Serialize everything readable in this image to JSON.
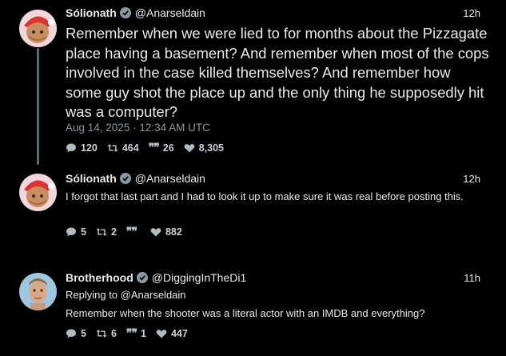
{
  "tweets": [
    {
      "author": "Sólionath",
      "handle": "@Anarseldain",
      "time": "12h",
      "text": "Remember when we were lied to for months about the Pizzagate place having a basement? And remember when most of the cops involved in the case killed themselves? And remember how some guy shot the place up and the only thing he supposedly hit was a computer?",
      "date": "Aug 14, 2025 · 12:34 AM UTC",
      "replies": "120",
      "retweets": "464",
      "quotes": "26",
      "likes": "8,305"
    },
    {
      "author": "Sólionath",
      "handle": "@Anarseldain",
      "time": "12h",
      "text": "I forgot that last part and I had to look it up to make sure it was real before posting this.",
      "replies": "5",
      "retweets": "2",
      "quotes": "",
      "likes": "882"
    },
    {
      "author": "Brotherhood",
      "handle": "@DiggingInTheDi1",
      "time": "11h",
      "reply_to_label": "Replying to",
      "reply_to_handle": "@Anarseldain",
      "text": "Remember when the shooter was a literal actor with an IMDB and everything?",
      "replies": "5",
      "retweets": "6",
      "quotes": "1",
      "likes": "447"
    }
  ],
  "icons": {
    "reply": "speech-bubble-icon",
    "retweet": "retweet-icon",
    "quote": "quote-icon",
    "like": "heart-icon",
    "verified": "verified-badge-icon"
  },
  "colors": {
    "background": "#000000",
    "text": "#e7e9ea",
    "muted": "#8b98a5",
    "verified": "#8899a6"
  }
}
